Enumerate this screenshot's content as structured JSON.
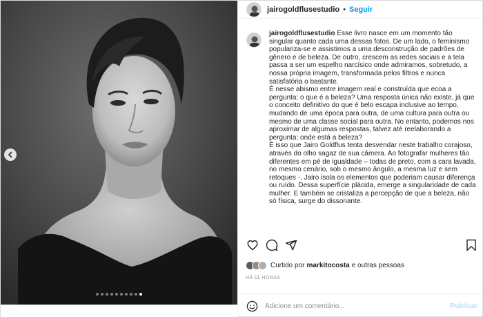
{
  "post": {
    "username": "jairogoldflusestudio",
    "separator": "•",
    "follow_label": "Seguir"
  },
  "caption": {
    "username": "jairogoldflusestudio",
    "paragraphs": [
      "Esse livro nasce em um momento tão singular quanto cada uma dessas fotos. De um lado, o feminismo populariza-se e assistimos a uma desconstrução de padrões de gênero e de beleza. De outro, crescem as redes sociais e a tela passa a ser um espelho narcísico onde admiramos, sobretudo, a nossa própria imagem, transformada pelos filtros e nunca satisfatória o bastante.",
      "É nesse abismo entre imagem real e construída que ecoa a pergunta: o que é a beleza? Uma resposta única não existe, já que o conceito definitivo do que é belo escapa inclusive ao tempo, mudando de uma época para outra, de uma cultura para outra ou mesmo de uma classe social para outra. No entanto, podemos nos aproximar de algumas respostas, talvez até reelaborando a pergunta: onde está a beleza?",
      "É isso que Jairo Goldflus tenta desvendar neste trabalho corajoso, através do olho sagaz de sua câmera. Ao fotografar mulheres tão diferentes em pé de igualdade – todas de preto, com a cara lavada, no mesmo cenário, sob o mesmo ângulo, a mesma luz e sem retoques -, Jairo isola os elementos que poderiam causar diferença ou ruído. Dessa superfície plácida, emerge a singularidade de cada mulher. E também se cristaliza a percepção de que a beleza, não só física, surge do dissonante."
    ]
  },
  "carousel": {
    "total": 10,
    "active_index": 9
  },
  "actions": {
    "like_icon": "heart-icon",
    "comment_icon": "comment-icon",
    "share_icon": "paper-plane-icon",
    "save_icon": "bookmark-icon"
  },
  "likes": {
    "prefix": "Curtido por",
    "user": "markitocosta",
    "suffix": "e outras pessoas"
  },
  "timestamp": "HÁ 11 HORAS",
  "comment_box": {
    "placeholder": "Adicione um comentário...",
    "publish_label": "Publicar"
  },
  "colors": {
    "accent": "#0095f6",
    "publish_disabled": "#b2dffc",
    "text": "#262626",
    "muted": "#8e8e8e"
  }
}
